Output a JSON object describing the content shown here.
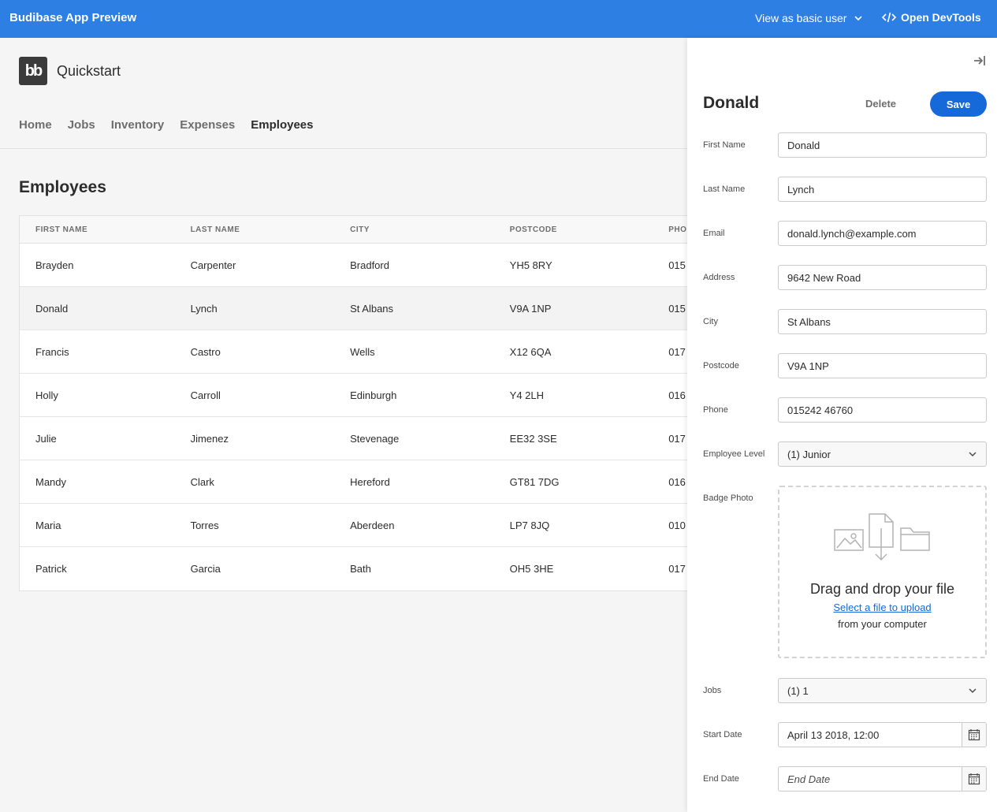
{
  "topbar": {
    "brand": "Budibase App Preview",
    "view_as": "View as basic user",
    "devtools": "Open DevTools"
  },
  "app": {
    "logo": "bb",
    "title": "Quickstart",
    "nav": [
      "Home",
      "Jobs",
      "Inventory",
      "Expenses",
      "Employees"
    ],
    "active_nav": "Employees"
  },
  "page": {
    "title": "Employees"
  },
  "table": {
    "columns": [
      "FIRST NAME",
      "LAST NAME",
      "CITY",
      "POSTCODE",
      "PHO"
    ],
    "rows": [
      [
        "Brayden",
        "Carpenter",
        "Bradford",
        "YH5 8RY",
        "015"
      ],
      [
        "Donald",
        "Lynch",
        "St Albans",
        "V9A 1NP",
        "015"
      ],
      [
        "Francis",
        "Castro",
        "Wells",
        "X12 6QA",
        "017"
      ],
      [
        "Holly",
        "Carroll",
        "Edinburgh",
        "Y4 2LH",
        "016"
      ],
      [
        "Julie",
        "Jimenez",
        "Stevenage",
        "EE32 3SE",
        "017"
      ],
      [
        "Mandy",
        "Clark",
        "Hereford",
        "GT81 7DG",
        "016"
      ],
      [
        "Maria",
        "Torres",
        "Aberdeen",
        "LP7 8JQ",
        "010"
      ],
      [
        "Patrick",
        "Garcia",
        "Bath",
        "OH5 3HE",
        "017"
      ]
    ],
    "selected_row": 1
  },
  "panel": {
    "title": "Donald",
    "delete_label": "Delete",
    "save_label": "Save",
    "fields": {
      "first_name": {
        "label": "First Name",
        "value": "Donald"
      },
      "last_name": {
        "label": "Last Name",
        "value": "Lynch"
      },
      "email": {
        "label": "Email",
        "value": "donald.lynch@example.com"
      },
      "address": {
        "label": "Address",
        "value": "9642 New Road"
      },
      "city": {
        "label": "City",
        "value": "St Albans"
      },
      "postcode": {
        "label": "Postcode",
        "value": "V9A 1NP"
      },
      "phone": {
        "label": "Phone",
        "value": "015242 46760"
      },
      "employee_level": {
        "label": "Employee Level",
        "value": "(1) Junior"
      },
      "jobs": {
        "label": "Jobs",
        "value": "(1) 1"
      },
      "start_date": {
        "label": "Start Date",
        "value": "April 13 2018, 12:00"
      },
      "end_date": {
        "label": "End Date",
        "placeholder": "End Date"
      }
    },
    "badge_photo": {
      "label": "Badge Photo",
      "title": "Drag and drop your file",
      "link": "Select a file to upload",
      "sub": "from your computer"
    }
  },
  "colors": {
    "topbar": "#2d7fe3",
    "accent": "#1569d8"
  }
}
